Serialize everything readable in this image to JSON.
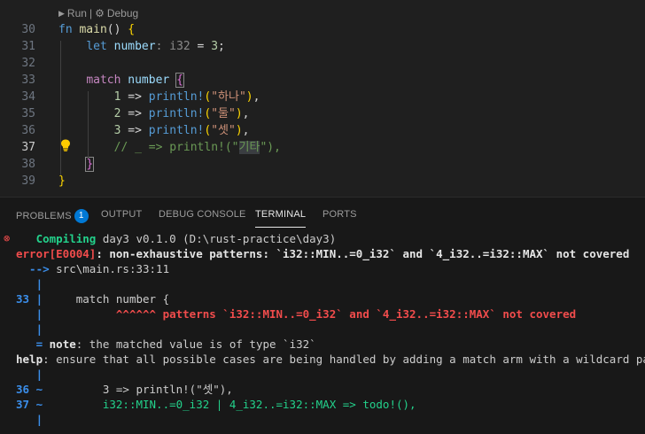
{
  "editor": {
    "codelens": {
      "run": "Run",
      "sep": "|",
      "debug": "Debug"
    },
    "lines": [
      {
        "num": "30",
        "tokens": [
          {
            "t": "fn",
            "c": "kw"
          },
          {
            "t": " ",
            "c": "pun"
          },
          {
            "t": "main",
            "c": "fn"
          },
          {
            "t": "() ",
            "c": "pun"
          },
          {
            "t": "{",
            "c": "br1"
          }
        ]
      },
      {
        "num": "31",
        "tokens": [
          {
            "t": "    ",
            "c": "pun"
          },
          {
            "t": "let",
            "c": "kw"
          },
          {
            "t": " ",
            "c": "pun"
          },
          {
            "t": "number",
            "c": "var"
          },
          {
            "t": ": i32",
            "c": "hint"
          },
          {
            "t": " = ",
            "c": "pun"
          },
          {
            "t": "3",
            "c": "num"
          },
          {
            "t": ";",
            "c": "pun"
          }
        ]
      },
      {
        "num": "32",
        "tokens": []
      },
      {
        "num": "33",
        "tokens": [
          {
            "t": "    ",
            "c": "pun"
          },
          {
            "t": "match",
            "c": "kw2"
          },
          {
            "t": " ",
            "c": "pun"
          },
          {
            "t": "number",
            "c": "var"
          },
          {
            "t": " ",
            "c": "pun"
          },
          {
            "t": "{",
            "c": "br2 brbox"
          }
        ]
      },
      {
        "num": "34",
        "tokens": [
          {
            "t": "        ",
            "c": "pun"
          },
          {
            "t": "1",
            "c": "num"
          },
          {
            "t": " => ",
            "c": "pun"
          },
          {
            "t": "println!",
            "c": "kw"
          },
          {
            "t": "(",
            "c": "br1"
          },
          {
            "t": "\"하나\"",
            "c": "str"
          },
          {
            "t": ")",
            "c": "br1"
          },
          {
            "t": ",",
            "c": "pun"
          }
        ]
      },
      {
        "num": "35",
        "tokens": [
          {
            "t": "        ",
            "c": "pun"
          },
          {
            "t": "2",
            "c": "num"
          },
          {
            "t": " => ",
            "c": "pun"
          },
          {
            "t": "println!",
            "c": "kw"
          },
          {
            "t": "(",
            "c": "br1"
          },
          {
            "t": "\"둘\"",
            "c": "str"
          },
          {
            "t": ")",
            "c": "br1"
          },
          {
            "t": ",",
            "c": "pun"
          }
        ]
      },
      {
        "num": "36",
        "tokens": [
          {
            "t": "        ",
            "c": "pun"
          },
          {
            "t": "3",
            "c": "num"
          },
          {
            "t": " => ",
            "c": "pun"
          },
          {
            "t": "println!",
            "c": "kw"
          },
          {
            "t": "(",
            "c": "br1"
          },
          {
            "t": "\"셋\"",
            "c": "str"
          },
          {
            "t": ")",
            "c": "br1"
          },
          {
            "t": ",",
            "c": "pun"
          }
        ]
      },
      {
        "num": "37",
        "active": true,
        "tokens": [
          {
            "t": "        ",
            "c": "pun"
          },
          {
            "t": "// _ => println!(\"",
            "c": "cmt"
          },
          {
            "t": "기타",
            "c": "cmt hl"
          },
          {
            "t": "\"),",
            "c": "cmt"
          }
        ]
      },
      {
        "num": "38",
        "tokens": [
          {
            "t": "    ",
            "c": "pun"
          },
          {
            "t": "}",
            "c": "br2 brbox"
          }
        ]
      },
      {
        "num": "39",
        "tokens": [
          {
            "t": "}",
            "c": "br1"
          }
        ]
      }
    ]
  },
  "panel": {
    "tabs": [
      {
        "label": "PROBLEMS",
        "badge": "1"
      },
      {
        "label": "OUTPUT"
      },
      {
        "label": "DEBUG CONSOLE"
      },
      {
        "label": "TERMINAL",
        "active": true
      },
      {
        "label": "PORTS"
      }
    ],
    "terminal": [
      {
        "spans": [
          {
            "t": "   Compiling",
            "c": "t-green b"
          },
          {
            "t": " day3 v0.1.0 (D:\\rust-practice\\day3)",
            "c": "t-norm"
          }
        ],
        "mark": "⊗"
      },
      {
        "spans": [
          {
            "t": "error[E0004]",
            "c": "t-red b"
          },
          {
            "t": ": non-exhaustive patterns: `i32::MIN..=0_i32` and `4_i32..=i32::MAX` not covered",
            "c": "t-white b"
          }
        ]
      },
      {
        "spans": [
          {
            "t": "  --> ",
            "c": "t-blue b"
          },
          {
            "t": "src\\main.rs:33:11",
            "c": "t-norm"
          }
        ]
      },
      {
        "spans": [
          {
            "t": "   |",
            "c": "t-blue b"
          }
        ]
      },
      {
        "spans": [
          {
            "t": "33 |",
            "c": "t-blue b"
          },
          {
            "t": "     match number {",
            "c": "t-norm"
          }
        ]
      },
      {
        "spans": [
          {
            "t": "   |",
            "c": "t-blue b"
          },
          {
            "t": "           ^^^^^^ patterns `i32::MIN..=0_i32` and `4_i32..=i32::MAX` not covered",
            "c": "t-red b"
          }
        ]
      },
      {
        "spans": [
          {
            "t": "   |",
            "c": "t-blue b"
          }
        ]
      },
      {
        "spans": [
          {
            "t": "   = ",
            "c": "t-blue b"
          },
          {
            "t": "note",
            "c": "t-white b"
          },
          {
            "t": ": the matched value is of type `i32`",
            "c": "t-norm"
          }
        ]
      },
      {
        "spans": [
          {
            "t": "help",
            "c": "t-white b"
          },
          {
            "t": ": ensure that all possible cases are being handled by adding a match arm with a wildcard pattern, as shown",
            "c": "t-norm"
          }
        ]
      },
      {
        "spans": [
          {
            "t": "   |",
            "c": "t-blue b"
          }
        ]
      },
      {
        "spans": [
          {
            "t": "36 ~",
            "c": "t-blue b"
          },
          {
            "t": "         3 => println!(\"셋\"),",
            "c": "t-norm"
          }
        ]
      },
      {
        "spans": [
          {
            "t": "37 ~",
            "c": "t-blue b"
          },
          {
            "t": "         i32::MIN..=0_i32 | 4_i32..=i32::MAX => todo!(),",
            "c": "t-green"
          }
        ]
      },
      {
        "spans": [
          {
            "t": "   |",
            "c": "t-blue b"
          }
        ]
      }
    ]
  }
}
